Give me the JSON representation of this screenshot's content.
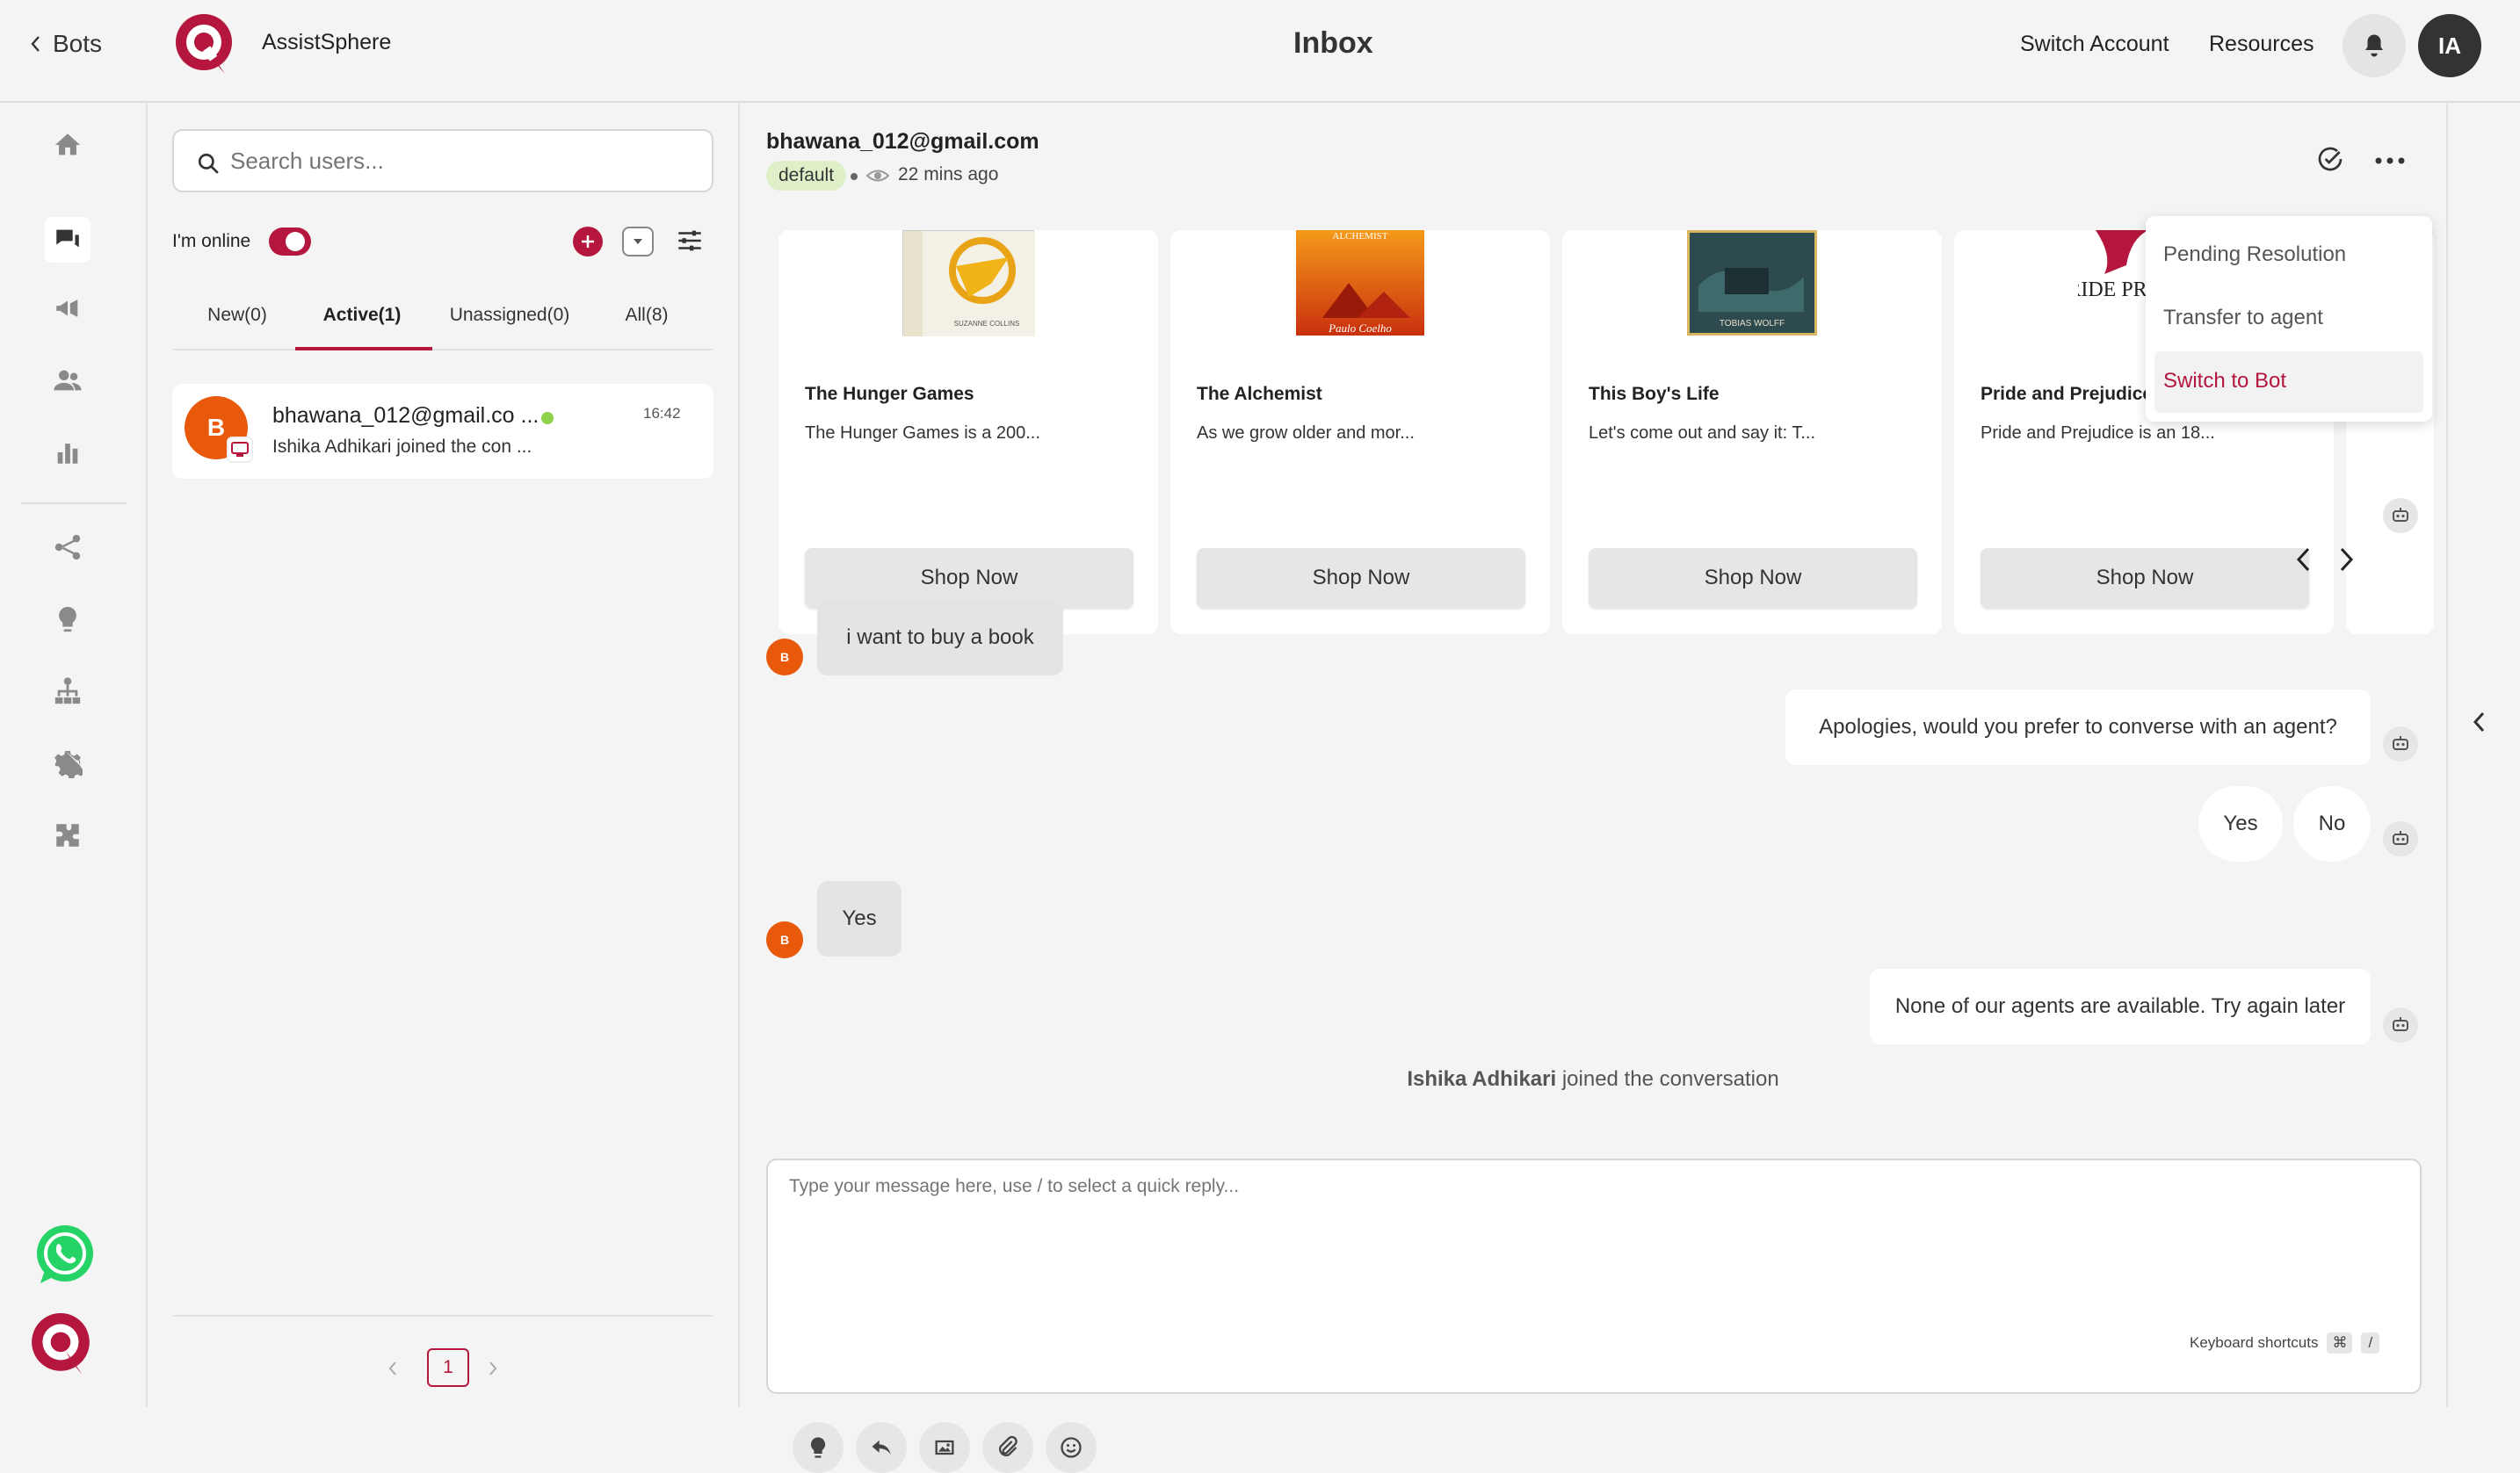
{
  "topbar": {
    "back_label": "Bots",
    "brand_name": "AssistSphere",
    "page_title": "Inbox",
    "switch_account": "Switch Account",
    "resources": "Resources",
    "user_initials": "IA"
  },
  "conversations": {
    "search_placeholder": "Search users...",
    "online_label": "I'm online",
    "tabs": [
      {
        "label": "New(0)"
      },
      {
        "label": "Active(1)"
      },
      {
        "label": "Unassigned(0)"
      },
      {
        "label": "All(8)"
      }
    ],
    "items": [
      {
        "avatar_letter": "B",
        "name": "bhawana_012@gmail.co ...",
        "time": "16:42",
        "preview": "Ishika Adhikari joined the con ..."
      }
    ],
    "page_number": "1"
  },
  "chat": {
    "user_email": "bhawana_012@gmail.com",
    "tag": "default",
    "last_seen": "22 mins ago",
    "cards": [
      {
        "title": "The Hunger Games",
        "desc": "The Hunger Games is a 200...",
        "button": "Shop Now",
        "cover_color": "#f3f0e6"
      },
      {
        "title": "The Alchemist",
        "desc": "As we grow older and mor...",
        "button": "Shop Now",
        "cover_color": "#e8740e",
        "cover_text": "ALCHEMIST",
        "cover_author": "Paulo Coelho"
      },
      {
        "title": "This Boy's Life",
        "desc": "Let's come out and say it: T...",
        "button": "Shop Now",
        "cover_color": "#2d4a4f",
        "cover_author": "TOBIAS WOLFF"
      },
      {
        "title": "Pride and Prejudice",
        "desc": "Pride and Prejudice is an 18...",
        "button": "Shop Now",
        "cover_color": "#ffffff",
        "cover_text": "PRIDE PREJUDICE"
      }
    ],
    "messages": {
      "user1": "i want to buy a book",
      "bot1": "Apologies, would you prefer to converse with an agent?",
      "quick_yes": "Yes",
      "quick_no": "No",
      "user2": "Yes",
      "bot2": "None of our agents are available. Try again later",
      "system_name": "Ishika Adhikari",
      "system_text": "joined the conversation",
      "user_avatar_letter": "B"
    },
    "composer_placeholder": "Type your message here, use / to select a quick reply...",
    "keyboard_shortcuts": "Keyboard shortcuts",
    "shortcut_key1": "⌘",
    "shortcut_key2": "/"
  },
  "menu": {
    "items": [
      {
        "label": "Pending Resolution"
      },
      {
        "label": "Transfer to agent"
      },
      {
        "label": "Switch to Bot"
      }
    ]
  },
  "colors": {
    "brand": "#b5163e",
    "online_dot": "#8ed14a",
    "tag_bg": "#dff0c8",
    "avatar_orange": "#e8590c",
    "whatsapp": "#25d366"
  }
}
